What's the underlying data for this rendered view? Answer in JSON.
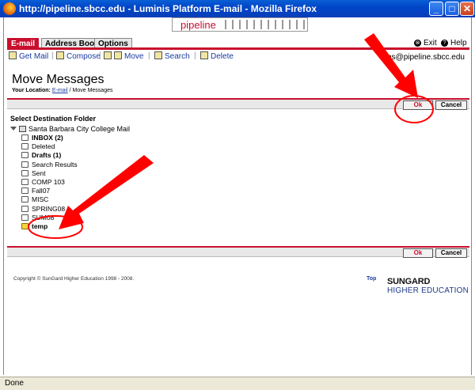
{
  "window": {
    "title": "http://pipeline.sbcc.edu - Luminis Platform E-mail - Mozilla Firefox",
    "minimize": "_",
    "maximize": "□",
    "close": "✕"
  },
  "banner": {
    "brand": "pipeline"
  },
  "tabs": [
    {
      "label": "E-mail",
      "active": true
    },
    {
      "label": "Address Book",
      "active": false
    },
    {
      "label": "Options",
      "active": false
    }
  ],
  "top_links": {
    "exit": "Exit",
    "help": "Help",
    "exit_icon": "⊗",
    "help_icon": "?"
  },
  "toolbar": {
    "get_mail": "Get Mail",
    "compose": "Compose",
    "move": "Move",
    "search": "Search",
    "delete": "Delete",
    "separator": "|"
  },
  "user_email": "tkins@pipeline.sbcc.edu",
  "page": {
    "heading": "Move Messages",
    "location_label": "Your Location:",
    "location_link": "E-mail",
    "location_rest": "/ Move Messages"
  },
  "buttons": {
    "ok": "Ok",
    "cancel": "Cancel"
  },
  "select_heading": "Select Destination Folder",
  "tree": {
    "root": "Santa Barbara City College Mail",
    "folders": [
      {
        "label": "INBOX (2)",
        "bold": true,
        "selected": false
      },
      {
        "label": "Deleted",
        "bold": false,
        "selected": false
      },
      {
        "label": "Drafts (1)",
        "bold": true,
        "selected": false
      },
      {
        "label": "Search Results",
        "bold": false,
        "selected": false
      },
      {
        "label": "Sent",
        "bold": false,
        "selected": false
      },
      {
        "label": "COMP 103",
        "bold": false,
        "selected": false
      },
      {
        "label": "Fall07",
        "bold": false,
        "selected": false
      },
      {
        "label": "MISC",
        "bold": false,
        "selected": false
      },
      {
        "label": "SPRING08",
        "bold": false,
        "selected": false
      },
      {
        "label": "SUM08",
        "bold": false,
        "selected": false
      },
      {
        "label": "temp",
        "bold": true,
        "selected": true
      }
    ]
  },
  "footer": {
    "copyright": "Copyright © SunGard Higher Education 1998 - 2008.",
    "top_link": "Top",
    "logo_line1": "SUNGARD",
    "logo_line2": "HIGHER EDUCATION"
  },
  "status": "Done",
  "colors": {
    "accent": "#c8102e",
    "link": "#1a3aa0",
    "annotation": "#ff0000"
  }
}
